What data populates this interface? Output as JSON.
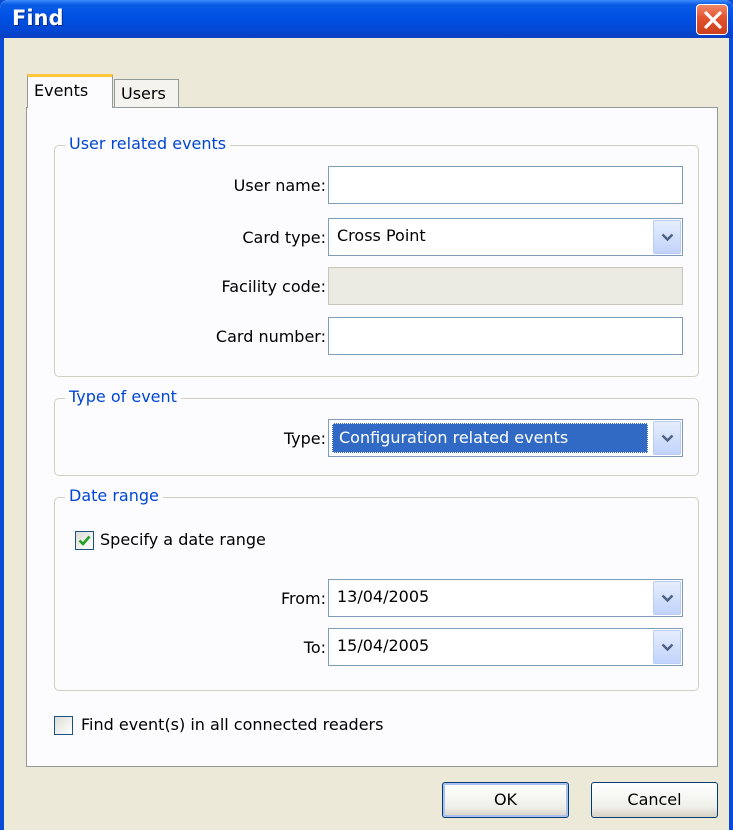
{
  "window": {
    "title": "Find"
  },
  "tabs": [
    {
      "label": "Events",
      "active": true
    },
    {
      "label": "Users",
      "active": false
    }
  ],
  "user_related": {
    "legend": "User related events",
    "user_name": {
      "label": "User name:",
      "value": ""
    },
    "card_type": {
      "label": "Card type:",
      "value": "Cross Point"
    },
    "facility_code": {
      "label": "Facility code:",
      "value": "",
      "disabled": true
    },
    "card_number": {
      "label": "Card number:",
      "value": ""
    }
  },
  "type_of_event": {
    "legend": "Type of event",
    "type": {
      "label": "Type:",
      "value": "Configuration related events"
    }
  },
  "date_range": {
    "legend": "Date range",
    "specify": {
      "label": "Specify a date range",
      "checked": true
    },
    "from": {
      "label": "From:",
      "value": "13/04/2005"
    },
    "to": {
      "label": "To:",
      "value": "15/04/2005"
    }
  },
  "all_readers": {
    "label": "Find event(s) in all connected readers",
    "checked": false
  },
  "buttons": {
    "ok": "OK",
    "cancel": "Cancel"
  },
  "colors": {
    "titlebar": "#0052e5",
    "legend": "#0046d5",
    "selection": "#316ac5",
    "tab_highlight": "#ffc83c"
  }
}
